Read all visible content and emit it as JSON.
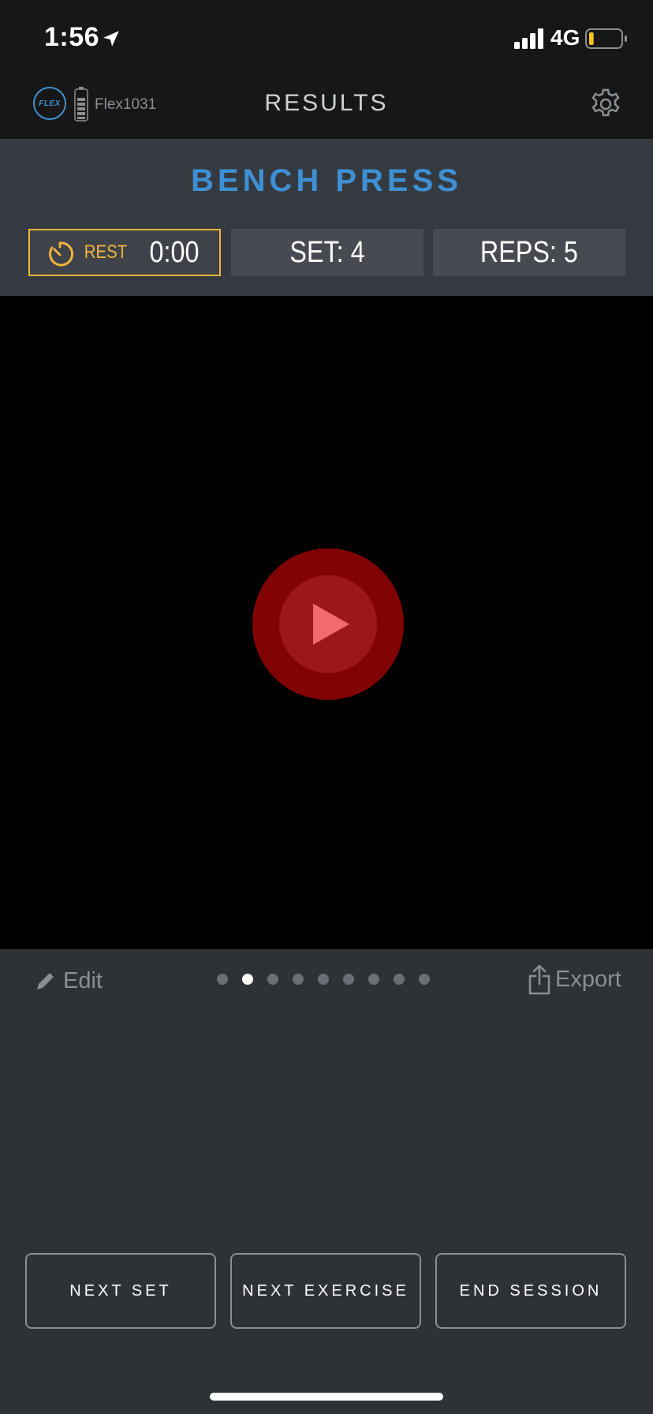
{
  "status_bar": {
    "time": "1:56",
    "network": "4G",
    "battery_level": 0.15
  },
  "header": {
    "logo_text": "FLEX",
    "device_name": "Flex1031",
    "title": "RESULTS"
  },
  "exercise": {
    "name": "BENCH PRESS",
    "rest_label": "REST",
    "rest_value": "0:00",
    "set_label": "SET: 4",
    "reps_label": "REPS: 5"
  },
  "controls": {
    "edit_label": "Edit",
    "export_label": "Export",
    "page_count": 9,
    "active_page": 2
  },
  "actions": {
    "next_set": "NEXT SET",
    "next_exercise": "NEXT EXERCISE",
    "end_session": "END SESSION"
  },
  "colors": {
    "accent_blue": "#3e90d4",
    "rest_orange": "#f2b33d",
    "play_red": "#820303",
    "background": "#2e3237"
  }
}
